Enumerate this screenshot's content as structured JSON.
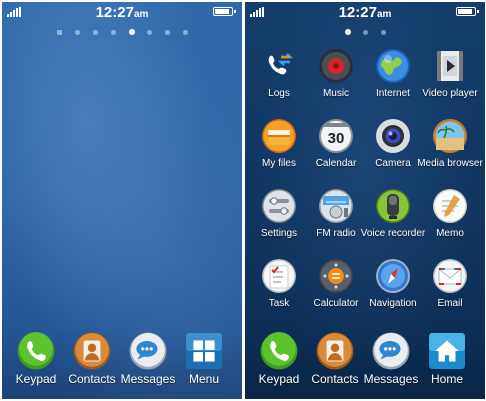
{
  "status": {
    "time": "12:27",
    "ampm": "am",
    "battery_level": 0.85
  },
  "left_screen": {
    "page_count": 8,
    "active_page": 4,
    "dock": [
      {
        "label": "Keypad",
        "icon": "phone-icon"
      },
      {
        "label": "Contacts",
        "icon": "contacts-icon"
      },
      {
        "label": "Messages",
        "icon": "messages-icon"
      },
      {
        "label": "Menu",
        "icon": "menu-grid-icon"
      }
    ]
  },
  "right_screen": {
    "page_count": 3,
    "active_page": 0,
    "apps": [
      {
        "label": "Logs",
        "icon": "logs-icon"
      },
      {
        "label": "Music",
        "icon": "music-icon"
      },
      {
        "label": "Internet",
        "icon": "globe-icon"
      },
      {
        "label": "Video player",
        "icon": "video-player-icon"
      },
      {
        "label": "My files",
        "icon": "folder-icon"
      },
      {
        "label": "Calendar",
        "icon": "calendar-icon"
      },
      {
        "label": "Camera",
        "icon": "camera-icon"
      },
      {
        "label": "Media browser",
        "icon": "media-browser-icon"
      },
      {
        "label": "Settings",
        "icon": "settings-icon"
      },
      {
        "label": "FM radio",
        "icon": "radio-icon"
      },
      {
        "label": "Voice recorder",
        "icon": "voice-recorder-icon"
      },
      {
        "label": "Memo",
        "icon": "memo-icon"
      },
      {
        "label": "Task",
        "icon": "task-icon"
      },
      {
        "label": "Calculator",
        "icon": "calculator-icon"
      },
      {
        "label": "Navigation",
        "icon": "compass-icon"
      },
      {
        "label": "Email",
        "icon": "email-icon"
      }
    ],
    "dock": [
      {
        "label": "Keypad",
        "icon": "phone-icon"
      },
      {
        "label": "Contacts",
        "icon": "contacts-icon"
      },
      {
        "label": "Messages",
        "icon": "messages-icon"
      },
      {
        "label": "Home",
        "icon": "home-icon"
      }
    ]
  },
  "calendar_day": "30"
}
